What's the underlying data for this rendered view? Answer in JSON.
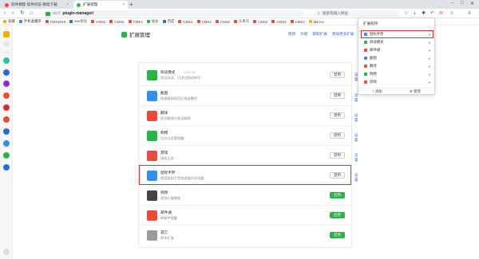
{
  "tabs": [
    {
      "title": "软件教程 软件问答 教程下载",
      "active": false
    },
    {
      "title": "扩展管理",
      "active": true
    }
  ],
  "new_tab_label": "+",
  "window_controls": [
    "–",
    "□",
    "✕"
  ],
  "toolbar": {
    "back": "‹",
    "forward": "›",
    "reload": "↻",
    "home": "⌂",
    "url_protocol": "se://",
    "url_host": "plugin-manager/",
    "search_placeholder": "搜索或输入网址",
    "search_icon": "search-icon"
  },
  "bookmarks": [
    {
      "label": "收藏",
      "color": "#f0b400"
    },
    {
      "label": "手机收藏夹",
      "color": "#3b8be8"
    },
    {
      "label": "CMS2019",
      "color": "#e84b3b"
    },
    {
      "label": "seo优化",
      "color": "#2b6bd1"
    },
    {
      "label": "CMS2",
      "color": "#e84b3b"
    },
    {
      "label": "CMS2",
      "color": "#e84b3b"
    },
    {
      "label": "CMS2",
      "color": "#e84b3b"
    },
    {
      "label": "站长",
      "color": "#2db24a"
    },
    {
      "label": "百度",
      "color": "#2b6bd1"
    },
    {
      "label": "CMS2",
      "color": "#e84b3b"
    },
    {
      "label": "CMS2",
      "color": "#e84b3b"
    },
    {
      "label": "CMS2",
      "color": "#e84b3b"
    },
    {
      "label": "头条号",
      "color": "#e84b3b"
    },
    {
      "label": "CMS2",
      "color": "#e84b3b"
    },
    {
      "label": "CMS2",
      "color": "#e84b3b"
    },
    {
      "label": "CMS2",
      "color": "#e84b3b"
    },
    {
      "label": "Micros",
      "color": "#f0b400"
    }
  ],
  "page": {
    "title": "扩展管理",
    "links": [
      "更新",
      "升级",
      "获取扩展",
      "添加更多扩展"
    ]
  },
  "extensions": [
    {
      "name": "阅读模式",
      "version": "1.0.1.14",
      "desc": "简洁阅读，沉浸式阅读体验",
      "button": "禁用",
      "link": "设置",
      "icon_color": "#2db24a",
      "green": false
    },
    {
      "name": "截图",
      "version": "",
      "desc": "快速截取网页区域或整页",
      "button": "禁用",
      "link": "设置",
      "icon_color": "#3b8be8",
      "green": false
    },
    {
      "name": "翻译",
      "version": "",
      "desc": "网页翻译与划词翻译",
      "button": "禁用",
      "link": "设置",
      "icon_color": "#e84b3b",
      "green": false
    },
    {
      "name": "购物",
      "version": "",
      "desc": "比价与优惠提醒",
      "button": "禁用",
      "link": "设置",
      "icon_color": "#2db24a",
      "green": false
    },
    {
      "name": "游戏",
      "version": "",
      "desc": "游戏工具",
      "button": "禁用",
      "link": "设置",
      "icon_color": "#e84b3b",
      "green": false
    },
    {
      "name": "鼠标手势",
      "version": "",
      "desc": "使用鼠标手势快速操作浏览器",
      "button": "禁用",
      "link": "设置",
      "icon_color": "#3b8be8",
      "green": false
    },
    {
      "name": "视频",
      "version": "",
      "desc": "视频小窗播放",
      "button": "启用",
      "link": "",
      "icon_color": "#444444",
      "green": true
    },
    {
      "name": "邮件通",
      "version": "",
      "desc": "新邮件提醒",
      "button": "启用",
      "link": "",
      "icon_color": "#e84b3b",
      "green": true
    },
    {
      "name": "其它",
      "version": "",
      "desc": "更多扩展",
      "button": "启用",
      "link": "",
      "icon_color": "#999999",
      "green": true
    }
  ],
  "popup": {
    "title": "扩展程序",
    "items": [
      {
        "label": "鼠标手势",
        "color": "#3b8be8",
        "pin": "⌖",
        "selected": true
      },
      {
        "label": "阅读模式",
        "color": "#2db24a",
        "pin": "⌖",
        "selected": false
      },
      {
        "label": "邮件通",
        "color": "#e84b3b",
        "pin": "⌖",
        "selected": false
      },
      {
        "label": "截图",
        "color": "#3b8be8",
        "pin": "⌖",
        "selected": false
      },
      {
        "label": "翻译",
        "color": "#e84b3b",
        "pin": "⌖",
        "selected": false
      },
      {
        "label": "购物",
        "color": "#2db24a",
        "pin": "⌖",
        "selected": false
      },
      {
        "label": "游戏",
        "color": "#e84b3b",
        "pin": "⌖",
        "selected": false
      }
    ],
    "add_label": "+ 添加",
    "manage_label": "⚙ 管理"
  }
}
